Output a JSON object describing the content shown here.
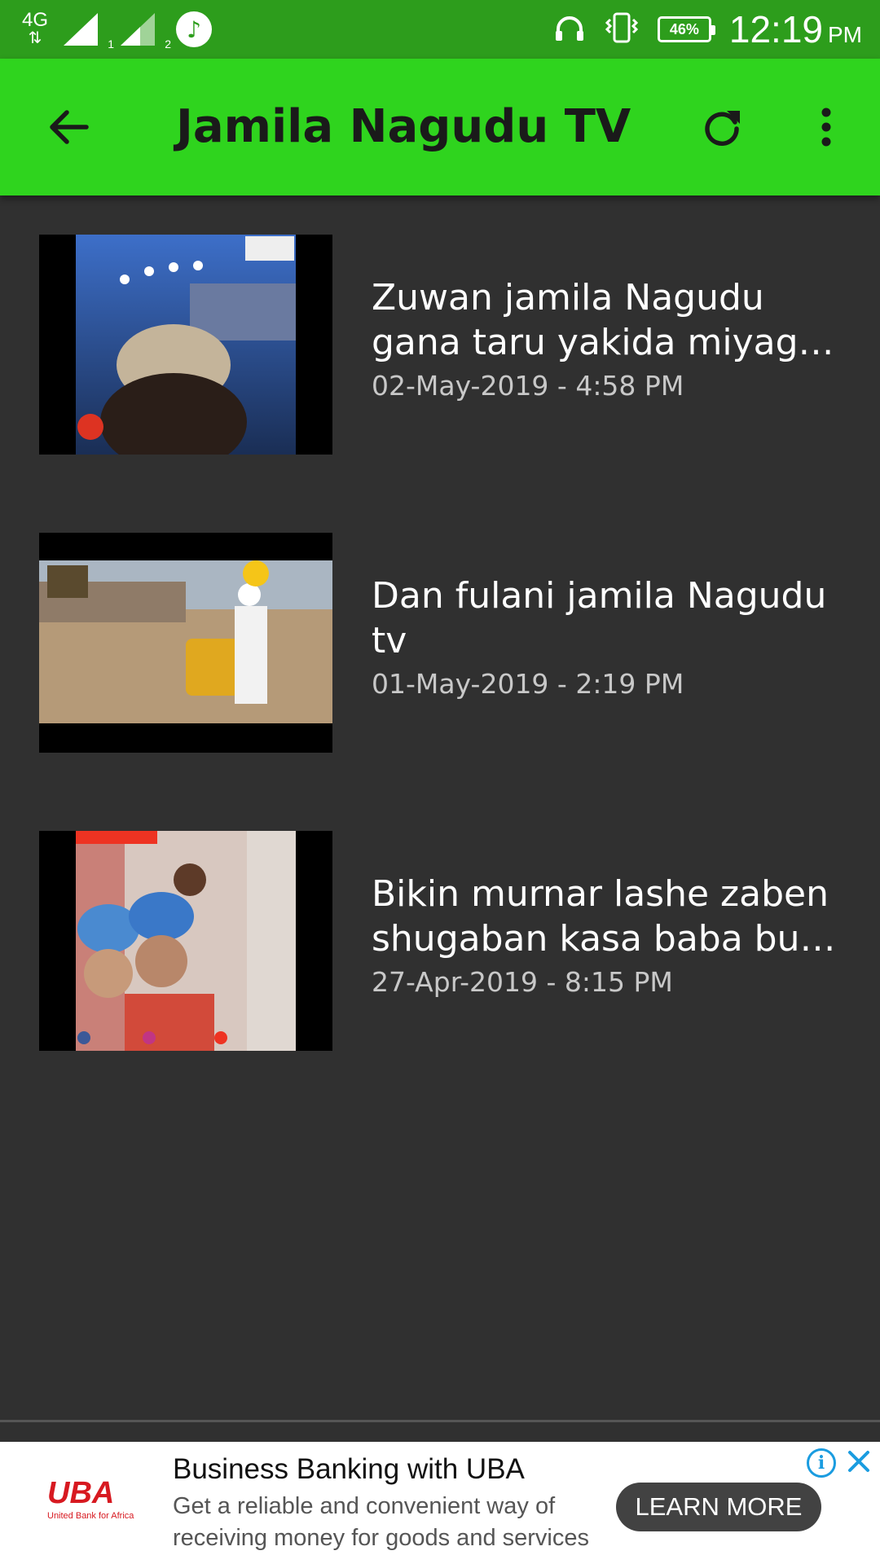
{
  "status_bar": {
    "network": "4G",
    "sim1": "1",
    "sim2": "2",
    "battery": "46%",
    "time": "12:19",
    "ampm": "PM"
  },
  "app_bar": {
    "title": "Jamila Nagudu TV"
  },
  "videos": [
    {
      "title_line1": "Zuwan jamila Nagudu",
      "title_line2": "gana taru yakida miyagu…",
      "date": "02-May-2019 - 4:58 PM"
    },
    {
      "title_line1": "Dan fulani jamila Nagudu",
      "title_line2": "tv",
      "date": "01-May-2019 - 2:19 PM"
    },
    {
      "title_line1": "Bikin murnar lashe zaben",
      "title_line2": "shugaban kasa baba buh…",
      "date": "27-Apr-2019 - 8:15 PM"
    }
  ],
  "ad": {
    "logo": "UBA",
    "logo_sub": "United Bank for Africa",
    "title": "Business Banking with UBA",
    "description": "Get a reliable and convenient way of receiving money for goods and services",
    "cta": "LEARN MORE"
  },
  "colors": {
    "status_bar": "#2d9d1c",
    "app_bar": "#2fd41e",
    "background": "#303030",
    "ad_brand": "#d71920"
  }
}
